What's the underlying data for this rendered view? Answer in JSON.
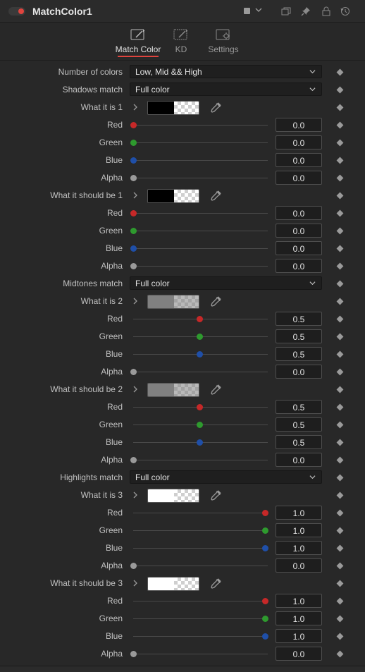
{
  "header": {
    "title": "MatchColor1",
    "toggle_color": "#e0443e",
    "color_swatch": "#9a9a9a",
    "icons": [
      "copy-icon",
      "pin-icon",
      "lock-icon",
      "reset-icon"
    ]
  },
  "tabs": [
    {
      "label": "Match Color",
      "active": true,
      "icon": "magic-wand-icon"
    },
    {
      "label": "KD",
      "active": false,
      "icon": "magic-wand-icon"
    },
    {
      "label": "Settings",
      "active": false,
      "icon": "gear-icon"
    }
  ],
  "controls": {
    "number_of_colors": {
      "label": "Number of colors",
      "value": "Low, Mid && High"
    },
    "shadows_match": {
      "label": "Shadows match",
      "value": "Full color"
    },
    "midtones_match": {
      "label": "Midtones match",
      "value": "Full color"
    },
    "highlights_match": {
      "label": "Highlights match",
      "value": "Full color"
    }
  },
  "channel_labels": {
    "red": "Red",
    "green": "Green",
    "blue": "Blue",
    "alpha": "Alpha"
  },
  "channel_colors": {
    "red": "#c62828",
    "green": "#2e9a2e",
    "blue": "#1f4fa8",
    "alpha": "#9a9a9a"
  },
  "color_groups": [
    {
      "id": "is1",
      "label": "What it is 1",
      "swatch": "#000000",
      "red": "0.0",
      "green": "0.0",
      "blue": "0.0",
      "alpha": "0.0",
      "red_f": 0.0,
      "green_f": 0.0,
      "blue_f": 0.0,
      "alpha_f": 0.0
    },
    {
      "id": "sb1",
      "label": "What it should be 1",
      "swatch": "#000000",
      "red": "0.0",
      "green": "0.0",
      "blue": "0.0",
      "alpha": "0.0",
      "red_f": 0.0,
      "green_f": 0.0,
      "blue_f": 0.0,
      "alpha_f": 0.0
    },
    {
      "id": "is2",
      "label": "What it is 2",
      "swatch": "#808080",
      "red": "0.5",
      "green": "0.5",
      "blue": "0.5",
      "alpha": "0.0",
      "red_f": 0.5,
      "green_f": 0.5,
      "blue_f": 0.5,
      "alpha_f": 0.0
    },
    {
      "id": "sb2",
      "label": "What it should be 2",
      "swatch": "#808080",
      "red": "0.5",
      "green": "0.5",
      "blue": "0.5",
      "alpha": "0.0",
      "red_f": 0.5,
      "green_f": 0.5,
      "blue_f": 0.5,
      "alpha_f": 0.0
    },
    {
      "id": "is3",
      "label": "What it is 3",
      "swatch": "#ffffff",
      "red": "1.0",
      "green": "1.0",
      "blue": "1.0",
      "alpha": "0.0",
      "red_f": 1.0,
      "green_f": 1.0,
      "blue_f": 1.0,
      "alpha_f": 0.0
    },
    {
      "id": "sb3",
      "label": "What it should be 3",
      "swatch": "#ffffff",
      "red": "1.0",
      "green": "1.0",
      "blue": "1.0",
      "alpha": "0.0",
      "red_f": 1.0,
      "green_f": 1.0,
      "blue_f": 1.0,
      "alpha_f": 0.0
    }
  ]
}
